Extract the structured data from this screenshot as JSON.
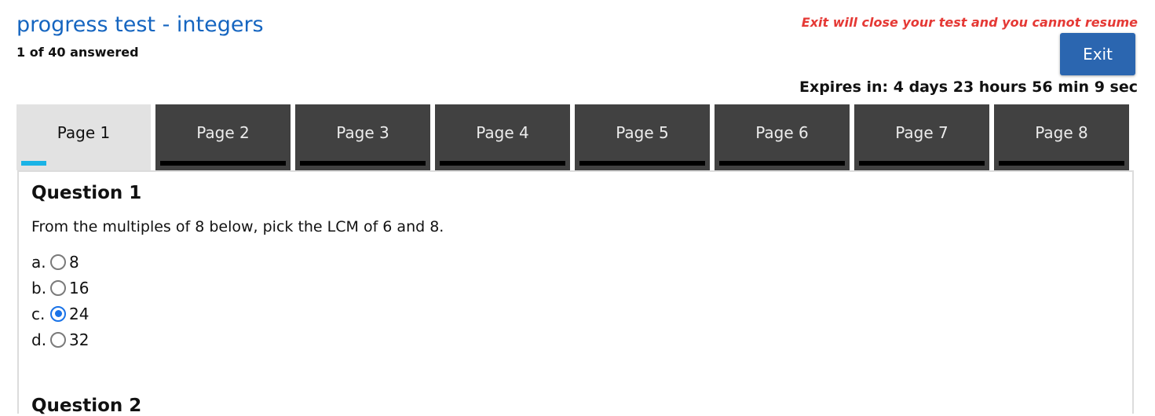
{
  "header": {
    "title": "progress test - integers",
    "answered": "1 of 40 answered",
    "exit_warning": "Exit will close your test and you cannot resume",
    "exit_label": "Exit",
    "expires": "Expires in: 4 days 23 hours 56 min 9 sec"
  },
  "tabs": [
    {
      "label": "Page 1",
      "active": true,
      "progress": 0.2
    },
    {
      "label": "Page 2",
      "active": false,
      "progress": 0
    },
    {
      "label": "Page 3",
      "active": false,
      "progress": 0
    },
    {
      "label": "Page 4",
      "active": false,
      "progress": 0
    },
    {
      "label": "Page 5",
      "active": false,
      "progress": 0
    },
    {
      "label": "Page 6",
      "active": false,
      "progress": 0
    },
    {
      "label": "Page 7",
      "active": false,
      "progress": 0
    },
    {
      "label": "Page 8",
      "active": false,
      "progress": 0
    }
  ],
  "questions": [
    {
      "title": "Question 1",
      "text": "From the multiples of 8 below, pick the LCM of 6 and 8.",
      "options": [
        {
          "letter": "a.",
          "value": "8",
          "selected": false
        },
        {
          "letter": "b.",
          "value": "16",
          "selected": false
        },
        {
          "letter": "c.",
          "value": "24",
          "selected": true
        },
        {
          "letter": "d.",
          "value": "32",
          "selected": false
        }
      ]
    },
    {
      "title": "Question 2"
    }
  ],
  "colors": {
    "title": "#1565c0",
    "warning": "#e53935",
    "exit_button": "#2b66b0",
    "tab_inactive": "#414141",
    "tab_active": "#e2e2e2",
    "tab_progress": "#1ab3e6",
    "radio_selected": "#1a73e8"
  }
}
